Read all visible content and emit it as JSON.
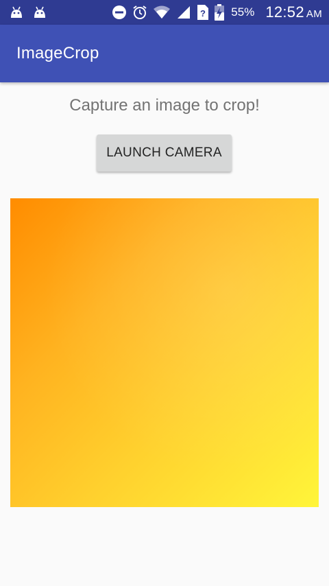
{
  "status_bar": {
    "left_icons": [
      "android-debug-icon",
      "android-debug-icon"
    ],
    "right_icons": [
      "do-not-disturb-icon",
      "alarm-clock-icon",
      "wifi-icon",
      "cell-signal-icon",
      "no-sim-icon",
      "battery-charging-icon"
    ],
    "battery_percent": "55%",
    "time": "12:52",
    "ampm": "AM"
  },
  "app_bar": {
    "title": "ImageCrop"
  },
  "main": {
    "prompt": "Capture an image to crop!",
    "launch_button_label": "LAUNCH CAMERA",
    "image_preview_name": "cropped-image-preview"
  },
  "colors": {
    "status_bar": "#2f3b92",
    "app_bar": "#3f51b5",
    "background": "#fafafa",
    "button": "#d6d7d7",
    "prompt_text": "#737373",
    "image_gradient_start": "#ff8c00",
    "image_gradient_end": "#fff53a"
  }
}
